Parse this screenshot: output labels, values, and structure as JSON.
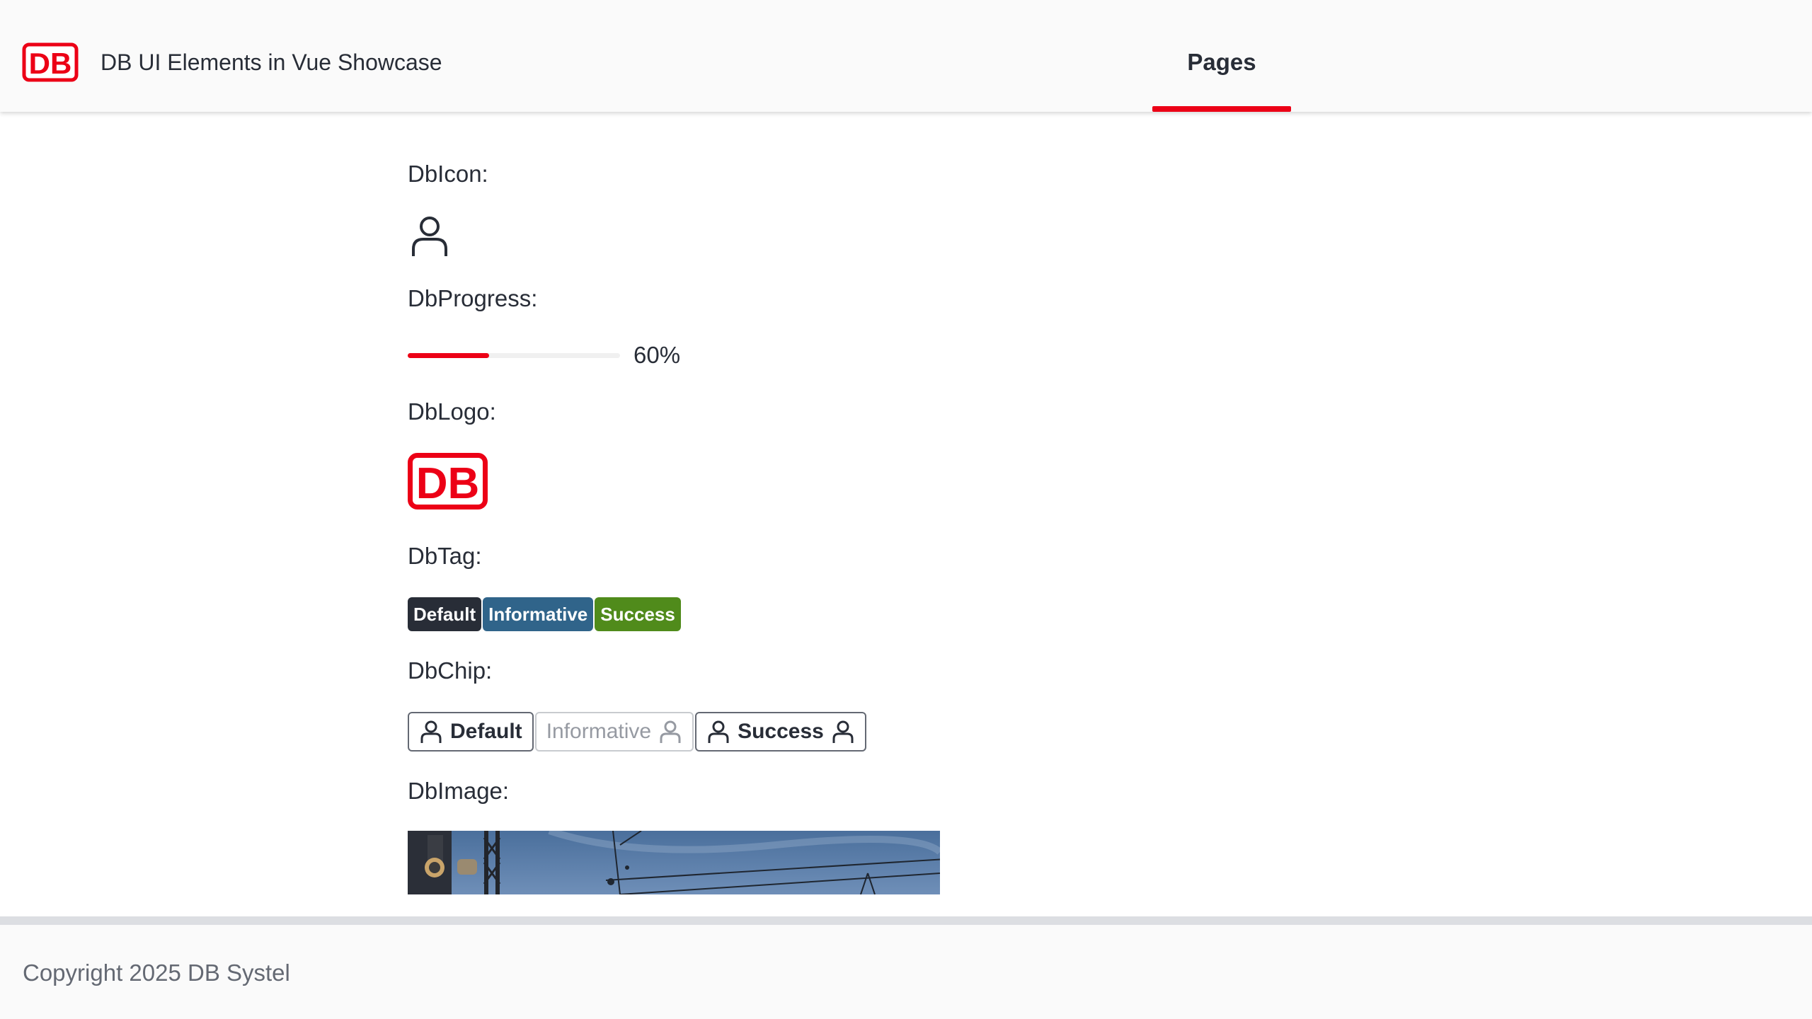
{
  "header": {
    "title": "DB UI Elements in Vue Showcase",
    "logo_text": "DB",
    "nav": [
      {
        "label": "Pages",
        "active": true
      }
    ]
  },
  "sections": {
    "icon_label": "DbIcon:",
    "progress_label": "DbProgress:",
    "logo_label": "DbLogo:",
    "tag_label": "DbTag:",
    "chip_label": "DbChip:",
    "image_label": "DbImage:"
  },
  "progress": {
    "value": 60,
    "text": "60%"
  },
  "logo": {
    "text": "DB"
  },
  "tags": [
    {
      "label": "Default",
      "color": "#282d37"
    },
    {
      "label": "Informative",
      "color": "#30648a"
    },
    {
      "label": "Success",
      "color": "#508b1b"
    }
  ],
  "chips": [
    {
      "label": "Default",
      "icon": "person-icon",
      "disabled": false
    },
    {
      "label": "Informative",
      "icon": "person-icon",
      "disabled": true
    },
    {
      "label": "Success",
      "icon": "person-icon",
      "disabled": false
    }
  ],
  "footer": {
    "copyright": "Copyright 2025 DB Systel"
  },
  "colors": {
    "brand_red": "#ec0016",
    "text": "#282d37",
    "muted": "#646973"
  }
}
